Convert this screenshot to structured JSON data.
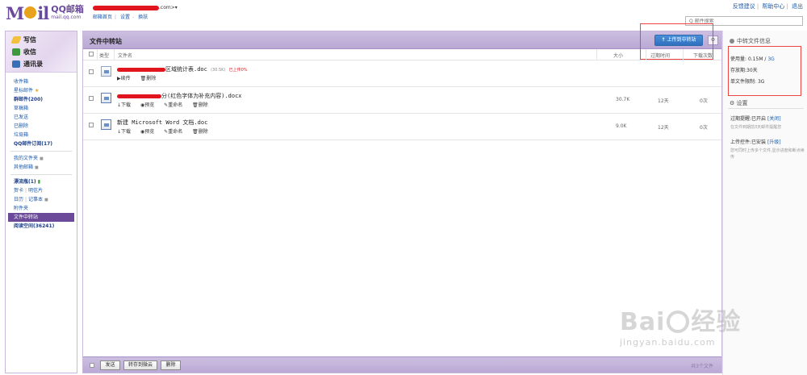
{
  "logo": {
    "mark_left": "M",
    "mark_right": "il",
    "name": "QQ邮箱",
    "domain": "mail.qq.com"
  },
  "account": {
    "suffix": ".com>",
    "caret": "▾"
  },
  "account_nav": {
    "home": "邮箱首页",
    "settings": "设置",
    "skin": "换肤"
  },
  "top_links": [
    "反馈建议",
    "帮助中心",
    "退出"
  ],
  "search": {
    "placeholder": "Q 邮件搜索"
  },
  "compose": {
    "write": "写信",
    "inbox": "收信",
    "contacts": "通讯录"
  },
  "folders": {
    "inbox": "收件箱",
    "starred": "星标邮件",
    "star_glyph": "★",
    "group": "群邮件(200)",
    "drafts": "草稿箱",
    "sent": "已发送",
    "deleted": "已删除",
    "spam": "垃圾箱",
    "subscriptions": "QQ邮件订阅(17)",
    "my_folders": "我的文件夹",
    "other_mailboxes": "其他邮箱",
    "drift_bottle": "漂流瓶(1)",
    "greeting_card": "贺卡",
    "postcard": "明信片",
    "calendar": "日历",
    "notepad": "记事本",
    "attachments": "附件夹",
    "file_transfer": "文件中转站",
    "reading_space": "阅读空间(36241)"
  },
  "main": {
    "title": "文件中转站",
    "upload_button": "上传到中转站",
    "columns": {
      "type": "类型",
      "filename": "文件名",
      "size": "大小",
      "expiry": "过期时间",
      "downloads": "下载次数"
    },
    "files": [
      {
        "name_suffix": "区域统计表.doc",
        "meta": "(30.5K)",
        "warning": "已上传0%",
        "actions": [
          "续传",
          "删除"
        ],
        "size": "",
        "expiry": "",
        "downloads": ""
      },
      {
        "name_suffix": "分(红色字体为补充内容).docx",
        "meta": "",
        "warning": "",
        "actions": [
          "下载",
          "预览",
          "重命名",
          "删除"
        ],
        "size": "30.7K",
        "expiry": "12天",
        "downloads": "0次"
      },
      {
        "name_suffix": "新建 Microsoft Word 文档.doc",
        "meta": "",
        "warning": "",
        "actions": [
          "下载",
          "预览",
          "重命名",
          "删除"
        ],
        "size": "9.0K",
        "expiry": "12天",
        "downloads": "0次"
      }
    ],
    "footer": {
      "send": "发送",
      "save_cloud": "转存到微云",
      "delete": "删除",
      "count": "共3个文件"
    }
  },
  "right_panel": {
    "title": "中转文件信息",
    "usage_label": "使用量:",
    "usage_value": "0.15M",
    "usage_total": "3G",
    "retention": "存放期:30天",
    "single_limit_label": "单文件限制:",
    "single_limit_value": "3G",
    "settings": "设置",
    "expiry_reminder_label": "过期提醒:已开启",
    "expiry_reminder_action": "[关闭]",
    "expiry_reminder_desc": "在文件到期前3天邮件提醒您",
    "upload_control_label": "上传控件:已安装",
    "upload_control_action": "[升级]",
    "upload_control_desc": "您可同时上传多个文件,显示进度和断点续传"
  },
  "watermark": {
    "big_left": "Bai",
    "big_right": "经验",
    "small": "jingyan.baidu.com"
  }
}
